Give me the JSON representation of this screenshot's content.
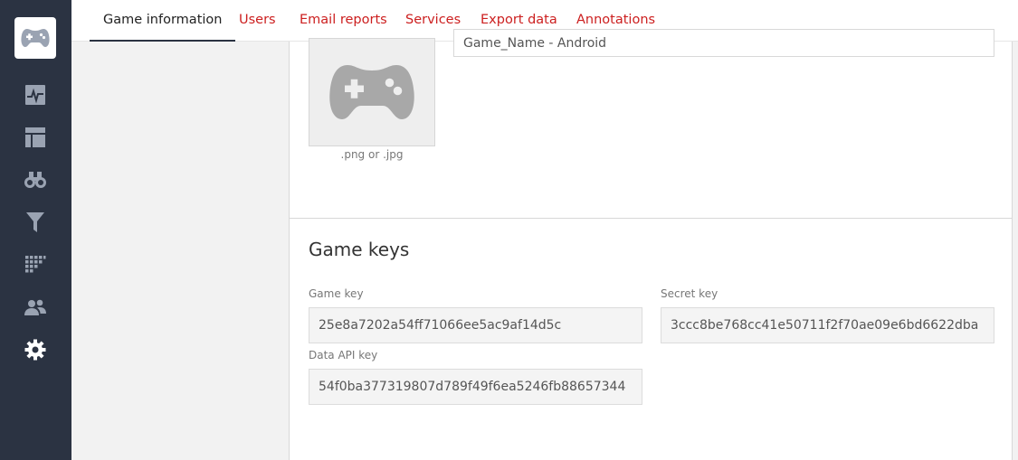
{
  "sidebar": {
    "logo_icon": "gamepad-icon",
    "items": [
      {
        "icon": "activity-chart-icon"
      },
      {
        "icon": "dashboard-icon"
      },
      {
        "icon": "binoculars-icon"
      },
      {
        "icon": "funnel-icon"
      },
      {
        "icon": "cohort-grid-icon"
      },
      {
        "icon": "users-icon"
      },
      {
        "icon": "gear-icon"
      }
    ]
  },
  "tabs": [
    {
      "label": "Game information",
      "active": true
    },
    {
      "label": "Users",
      "active": false
    },
    {
      "label": "Email reports",
      "active": false
    },
    {
      "label": "Services",
      "active": false
    },
    {
      "label": "Export data",
      "active": false
    },
    {
      "label": "Annotations",
      "active": false
    }
  ],
  "game_info": {
    "name_value": "Game_Name - Android",
    "image_hint": ".png or .jpg"
  },
  "game_keys": {
    "title": "Game keys",
    "game_key_label": "Game key",
    "game_key_value": "25e8a7202a54ff71066ee5ac9af14d5c",
    "secret_key_label": "Secret key",
    "secret_key_value": "3ccc8be768cc41e50711f2f70ae09e6bd6622dba",
    "data_api_key_label": "Data API key",
    "data_api_key_value": "54f0ba377319807d789f49f6ea5246fb88657344"
  },
  "colors": {
    "sidebar_bg": "#2b3342",
    "tab_link": "#cc1f1f",
    "icon": "#9aa3b2"
  }
}
